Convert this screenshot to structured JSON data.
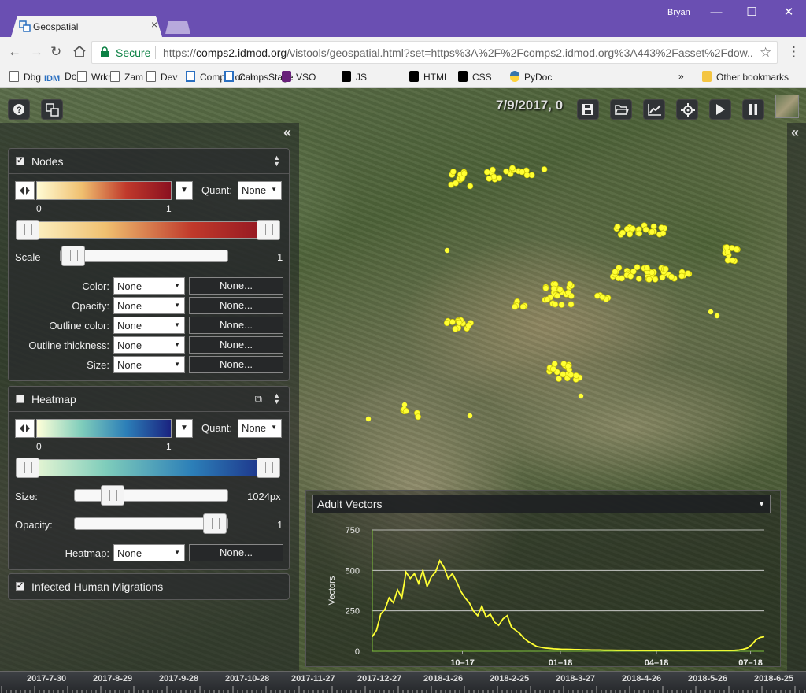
{
  "browser": {
    "tab_title": "Geospatial",
    "tab_close": "×",
    "user": "Bryan",
    "secure_label": "Secure",
    "url_prefix": "https://",
    "url_host": "comps2.idmod.org",
    "url_rest": "/vistools/geospatial.html?set=https%3A%2F%2Fcomps2.idmod.org%3A443%2Fasset%2Fdow..."
  },
  "bookmarks": [
    {
      "label": "Dbg",
      "icon": "document-icon"
    },
    {
      "label": "Dox",
      "icon": "idm-icon",
      "badge": "IDM"
    },
    {
      "label": "Wrkrs",
      "icon": "document-icon"
    },
    {
      "label": "Zam",
      "icon": "document-icon"
    },
    {
      "label": "Dev",
      "icon": "document-icon"
    },
    {
      "label": "CompsLocal",
      "icon": "comps-icon"
    },
    {
      "label": "CompsStage",
      "icon": "comps-icon"
    },
    {
      "label": "VSO",
      "icon": "vs-icon"
    },
    {
      "label": "JS",
      "icon": "mdn-icon"
    },
    {
      "label": "HTML",
      "icon": "mdn-icon"
    },
    {
      "label": "CSS",
      "icon": "mdn-icon"
    },
    {
      "label": "PyDoc",
      "icon": "python-icon"
    },
    {
      "label": "»",
      "icon": ""
    },
    {
      "label": "Other bookmarks",
      "icon": "folder-icon"
    }
  ],
  "viewer": {
    "date_label": "7/9/2017, 0",
    "toolbar_icons": [
      "help-icon",
      "layers-icon",
      "save-icon",
      "open-folder-icon",
      "chart-icon",
      "target-icon",
      "play-icon",
      "pause-icon",
      "basemap-thumbnail"
    ],
    "collapse_glyph": "«"
  },
  "nodes_panel": {
    "title": "Nodes",
    "checked": true,
    "quant_label": "Quant:",
    "quant_value": "None",
    "range_min": "0",
    "range_max": "1",
    "scale_label": "Scale",
    "scale_value": "1",
    "scale_level": 0.0,
    "colors": [
      "#fffbd4",
      "#f0c070",
      "#c0392b",
      "#8b1020"
    ],
    "props": [
      {
        "label": "Color:",
        "value": "None",
        "button": "None..."
      },
      {
        "label": "Opacity:",
        "value": "None",
        "button": "None..."
      },
      {
        "label": "Outline color:",
        "value": "None",
        "button": "None..."
      },
      {
        "label": "Outline thickness:",
        "value": "None",
        "button": "None..."
      },
      {
        "label": "Size:",
        "value": "None",
        "button": "None..."
      }
    ]
  },
  "heatmap_panel": {
    "title": "Heatmap",
    "checked": false,
    "quant_label": "Quant:",
    "quant_value": "None",
    "range_min": "0",
    "range_max": "1",
    "size_label": "Size:",
    "size_value": "1024px",
    "size_level": 0.2,
    "opacity_label": "Opacity:",
    "opacity_value": "1",
    "opacity_level": 1.0,
    "heatmap_label": "Heatmap:",
    "heatmap_value": "None",
    "heatmap_button": "None...",
    "colors": [
      "#ffffd9",
      "#7fcdbb",
      "#2c7fb8",
      "#1a2380"
    ]
  },
  "migrations_panel": {
    "title": "Infected Human Migrations",
    "checked": true
  },
  "chart_data": {
    "type": "line",
    "selector": "Adult Vectors",
    "title": "",
    "xlabel": "",
    "ylabel": "Vectors",
    "ylim": [
      0,
      750
    ],
    "yticks": [
      "750",
      "500",
      "250",
      "0"
    ],
    "xticks": [
      {
        "label": "10–17",
        "x": 0.23
      },
      {
        "label": "01–18",
        "x": 0.48
      },
      {
        "label": "04–18",
        "x": 0.725
      },
      {
        "label": "07–18",
        "x": 0.965
      }
    ],
    "grid": true,
    "color": "#ffff33",
    "series": [
      {
        "values": [
          90,
          130,
          230,
          260,
          330,
          300,
          380,
          330,
          490,
          450,
          480,
          420,
          500,
          400,
          460,
          490,
          560,
          520,
          450,
          480,
          430,
          370,
          330,
          300,
          250,
          220,
          280,
          210,
          230,
          180,
          160,
          200,
          220,
          150,
          130,
          110,
          80,
          60,
          45,
          30,
          25,
          20,
          18,
          15,
          14,
          12,
          12,
          11,
          10,
          10,
          9,
          9,
          8,
          8,
          8,
          7,
          7,
          7,
          6,
          6,
          6,
          6,
          5,
          5,
          5,
          5,
          5,
          5,
          5,
          5,
          5,
          5,
          5,
          5,
          5,
          5,
          5,
          5,
          5,
          5,
          5,
          5,
          5,
          5,
          5,
          5,
          6,
          8,
          12,
          20,
          40,
          70,
          85,
          90
        ]
      }
    ]
  },
  "timeline": {
    "labels": [
      "2017-7-30",
      "2017-8-29",
      "2017-9-28",
      "2017-10-28",
      "2017-11-27",
      "2017-12-27",
      "2018-1-26",
      "2018-2-25",
      "2018-3-27",
      "2018-4-26",
      "2018-5-26",
      "2018-6-25"
    ]
  }
}
